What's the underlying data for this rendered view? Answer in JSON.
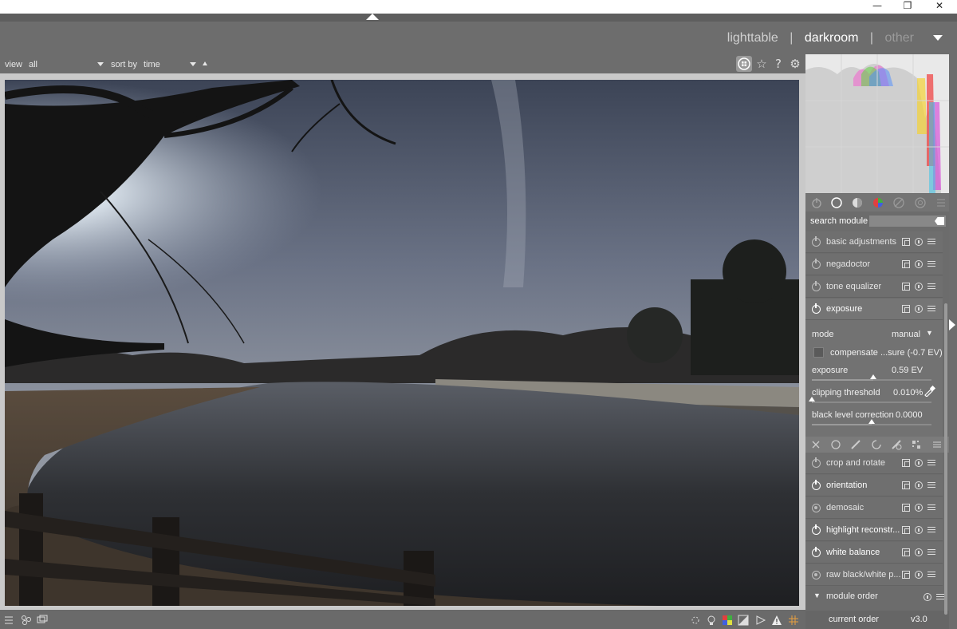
{
  "window": {
    "minimize": "—",
    "restore": "❐",
    "close": "✕"
  },
  "views": {
    "lighttable": "lighttable",
    "sep1": "|",
    "darkroom": "darkroom",
    "sep2": "|",
    "other": "other"
  },
  "filter": {
    "view_label": "view",
    "view_value": "all",
    "sort_label": "sort by",
    "sort_value": "time"
  },
  "toolbar_icons": {
    "grid": "grid-icon",
    "star": "☆",
    "help": "?",
    "gear": "⚙"
  },
  "search": {
    "label": "search module",
    "value": ""
  },
  "modules_top": [
    {
      "label": "basic adjustments",
      "state": "off"
    },
    {
      "label": "negadoctor",
      "state": "off"
    },
    {
      "label": "tone equalizer",
      "state": "off"
    },
    {
      "label": "exposure",
      "state": "on"
    }
  ],
  "exposure": {
    "mode_label": "mode",
    "mode_value": "manual",
    "compensate_label": "compensate ...sure (-0.7 EV)",
    "exposure_label": "exposure",
    "exposure_value": "0.59 EV",
    "exposure_level": 0.59,
    "clipping_label": "clipping threshold",
    "clipping_value": "0.010%",
    "clipping_level": 0.01,
    "black_label": "black level correction",
    "black_value": "0.0000",
    "black_level": 0.0
  },
  "modules_bottom": [
    {
      "label": "crop and rotate",
      "state": "off"
    },
    {
      "label": "orientation",
      "state": "on"
    },
    {
      "label": "demosaic",
      "state": "always"
    },
    {
      "label": "highlight reconstr...",
      "state": "on"
    },
    {
      "label": "white balance",
      "state": "on"
    },
    {
      "label": "raw black/white p...",
      "state": "always"
    }
  ],
  "module_order": {
    "label": "module order",
    "current_label": "current order",
    "current_value": "v3.0"
  },
  "colors": {
    "background": "#6d6d6d",
    "panel": "#6f6f6f",
    "canvas_border": "#c9c9c9",
    "active_text": "#ffffff"
  }
}
